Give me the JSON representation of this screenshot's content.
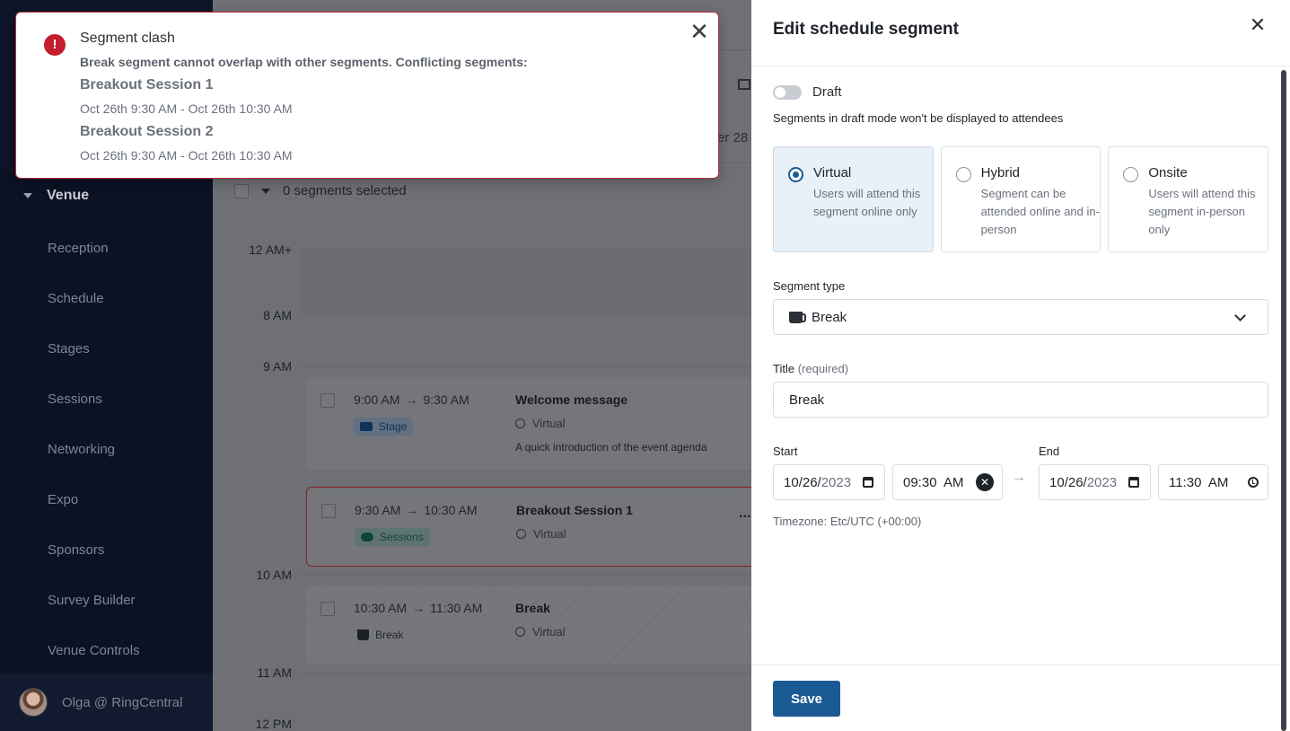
{
  "sidebar": {
    "section": "Venue",
    "items": [
      {
        "label": "Reception"
      },
      {
        "label": "Schedule"
      },
      {
        "label": "Stages"
      },
      {
        "label": "Sessions"
      },
      {
        "label": "Networking"
      },
      {
        "label": "Expo"
      },
      {
        "label": "Sponsors"
      },
      {
        "label": "Survey Builder"
      },
      {
        "label": "Venue Controls"
      }
    ],
    "user": "Olga @ RingCentral"
  },
  "main": {
    "date_fragment": "er 28",
    "selection_text": "0 segments selected",
    "time_labels": [
      "12 AM+",
      "8 AM",
      "9 AM",
      "10 AM",
      "11 AM",
      "12 PM"
    ],
    "segments": [
      {
        "start": "9:00 AM",
        "arrow": "→",
        "end": "9:30 AM",
        "tag": "Stage",
        "title": "Welcome message",
        "mode": "Virtual",
        "description": "A quick introduction of the event agenda"
      },
      {
        "start": "9:30 AM",
        "arrow": "→",
        "end": "10:30 AM",
        "tag": "Sessions",
        "title": "Breakout Session 1",
        "mode": "Virtual",
        "more": "..."
      },
      {
        "start": "10:30 AM",
        "arrow": "→",
        "end": "11:30 AM",
        "tag": "Break",
        "title": "Break",
        "mode": "Virtual"
      }
    ]
  },
  "panel": {
    "title": "Edit schedule segment",
    "close": "✕",
    "draft_label": "Draft",
    "draft_help": "Segments in draft mode won't be displayed to attendees",
    "modes": [
      {
        "name": "Virtual",
        "desc": "Users will attend this segment online only",
        "selected": true
      },
      {
        "name": "Hybrid",
        "desc": "Segment can be attended online and in-person",
        "selected": false
      },
      {
        "name": "Onsite",
        "desc": "Users will attend this segment in-person only",
        "selected": false
      }
    ],
    "segment_type_label": "Segment type",
    "segment_type_value": "Break",
    "title_label": "Title",
    "title_required": "(required)",
    "title_value": "Break",
    "start_label": "Start",
    "end_label": "End",
    "start_date": {
      "m": "10",
      "d": "26",
      "y": "2023"
    },
    "start_time": "09:30  AM",
    "end_date": {
      "m": "10",
      "d": "26",
      "y": "2023"
    },
    "end_time": "11:30  AM",
    "range_arrow": "→",
    "timezone": "Timezone: Etc/UTC (+00:00)",
    "save": "Save"
  },
  "toast": {
    "icon": "!",
    "title": "Segment clash",
    "message": "Break segment cannot overlap with other segments. Conflicting segments:",
    "conflicts": [
      {
        "name": "Breakout Session 1",
        "time": "Oct 26th 9:30 AM - Oct 26th 10:30 AM"
      },
      {
        "name": "Breakout Session 2",
        "time": "Oct 26th 9:30 AM - Oct 26th 10:30 AM"
      }
    ],
    "close": "✕"
  },
  "colors": {
    "accent": "#1b5a93",
    "error": "#c41d2e",
    "sidebar_bg": "#0c1224"
  }
}
